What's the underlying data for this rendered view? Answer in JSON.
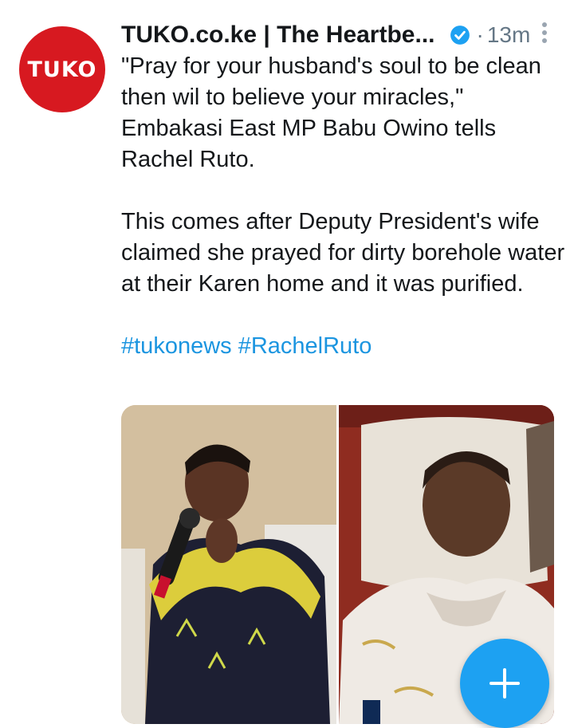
{
  "tweet": {
    "avatar_text": "TUKO",
    "display_name": "TUKO.co.ke | The Heartbe...",
    "separator": "·",
    "time": "13m",
    "paragraphs": [
      "\"Pray for your husband's soul to be clean then wil to believe your miracles,\" Embakasi East MP Babu Owino tells Rachel Ruto.",
      "This comes after Deputy President's wife claimed she prayed for dirty borehole water at their Karen home and it was purified."
    ],
    "hashtags": [
      "#tukonews",
      "#RachelRuto"
    ]
  },
  "icons": {
    "verified": "verified-badge-icon",
    "more": "more-vertical-icon",
    "compose": "plus-icon"
  },
  "colors": {
    "brand_red": "#d71920",
    "link_blue": "#1b95e0",
    "fab_blue": "#1da1f2",
    "muted": "#657786"
  }
}
